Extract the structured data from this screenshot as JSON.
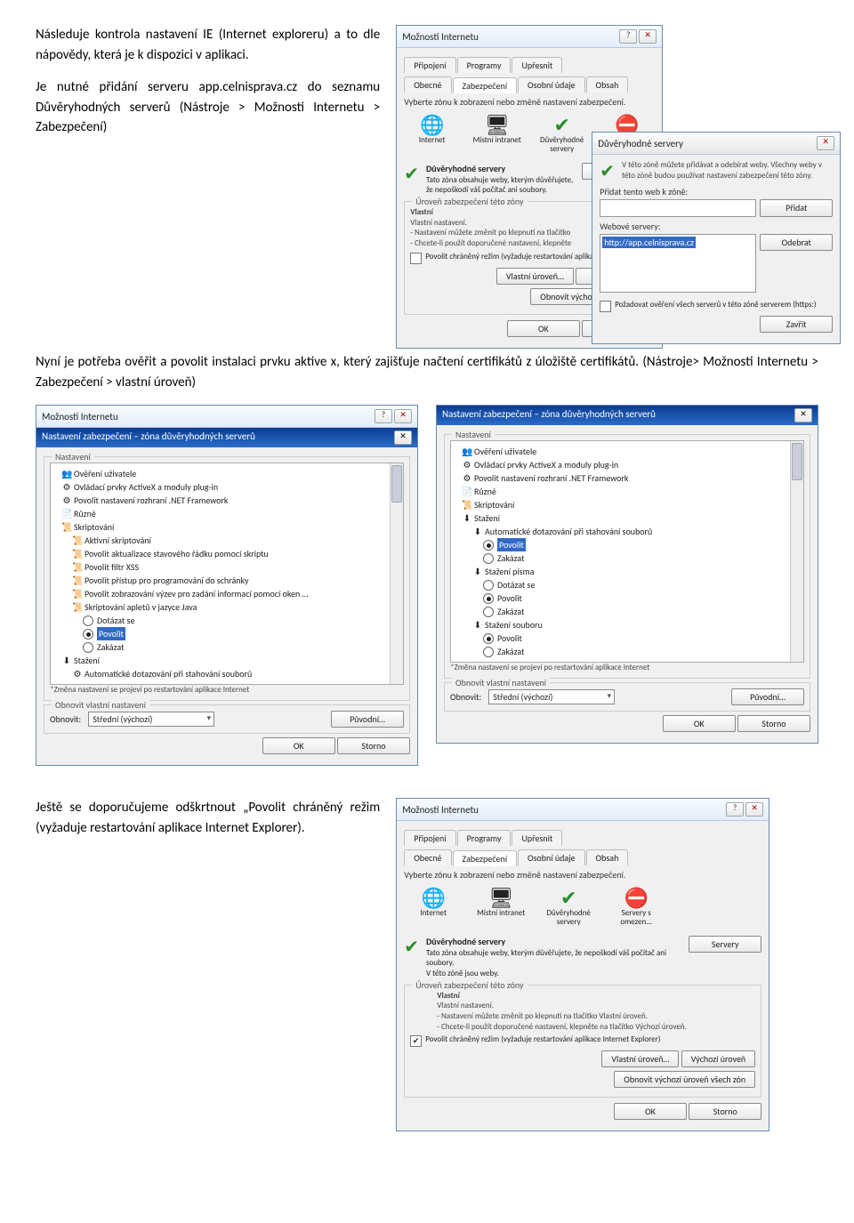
{
  "para1": "Následuje kontrola nastavení IE (Internet exploreru) a to dle nápovědy, která je k dispozici v aplikaci.",
  "para2": "Je nutné přidání serveru app.celnisprava.cz do seznamu Důvěryhodných serverů (Nástroje > Možnosti Internetu > Zabezpečení)",
  "para3": "Nyní je potřeba ověřit a povolit instalaci prvku aktive x, který zajišťuje načtení certifikátů z úložiště certifikátů. (Nástroje> Možnosti Internetu > Zabezpečení > vlastní úroveň)",
  "para4": "Ještě se doporučujeme odškrtnout „Povolit chráněný režim (vyžaduje restartování aplikace Internet Explorer).",
  "win_iopts": {
    "title": "Možnosti Internetu",
    "tabs_row1": [
      "Připojení",
      "Programy",
      "Upřesnit"
    ],
    "tabs_row2": [
      "Obecné",
      "Zabezpečení",
      "Osobní údaje",
      "Obsah"
    ],
    "zone_instr": "Vyberte zónu k zobrazení nebo změně nastavení zabezpečení.",
    "zones": [
      {
        "icon": "🌐",
        "label": "Internet"
      },
      {
        "icon": "🖥",
        "label": "Místní intranet"
      },
      {
        "icon": "✔",
        "label": "Důvěryhodné servery",
        "cls": "chk"
      },
      {
        "icon": "⛔",
        "label": "Servery s omezen...",
        "cls": "no"
      }
    ],
    "trusted_title": "Důvěryhodné servery",
    "trusted_desc": "Tato zóna obsahuje weby, kterým důvěřujete, že nepoškodí váš počítač ani soubory.",
    "trusted_desc2": "V této zóně jsou weby.",
    "servers_btn": "Servery",
    "level_legend": "Úroveň zabezpečení této zóny",
    "level_name": "Vlastní",
    "level_line1": "Vlastní nastavení.",
    "level_line2": "- Nastavení můžete změnit po klepnutí na tlačítko Vlastní úroveň.",
    "level_line3": "- Chcete-li použít doporučené nastavení, klepněte na tlačítko Výchozí úroveň.",
    "cb_protected": "Povolit chráněný režim (vyžaduje restartování aplikace Internet Explorer)",
    "btn_custom": "Vlastní úroveň…",
    "btn_default": "Výchozí úroveň",
    "btn_reset": "Obnovit výchozí úroveň všech zón",
    "ok": "OK",
    "cancel": "Storno"
  },
  "win_trusted": {
    "title": "Důvěryhodné servery",
    "info": "V této zóně můžete přidávat a odebírat weby. Všechny weby v této zóně budou používat nastavení zabezpečení této zóny.",
    "add_web_lbl": "Přidat tento web k zóně:",
    "add_btn": "Přidat",
    "list_lbl": "Webové servery:",
    "list_item": "http://app.celnisprava.cz",
    "remove_btn": "Odebrat",
    "require_https": "Požadovat ověření všech serverů v této zóně serverem (https:)",
    "close_btn": "Zavřít"
  },
  "win_sec_left": {
    "title": "Možnosti Internetu",
    "subtitle": "Nastavení zabezpečení – zóna důvěryhodných serverů",
    "legend": "Nastavení",
    "items": [
      {
        "ic": "👥",
        "txt": "Ověření uživatele",
        "lvl": 1
      },
      {
        "ic": "⚙",
        "txt": "Ovládací prvky ActiveX a moduly plug-in",
        "lvl": 1
      },
      {
        "ic": "⚙",
        "txt": "Povolit nastavení rozhraní .NET Framework",
        "lvl": 1
      },
      {
        "ic": "📄",
        "txt": "Různé",
        "lvl": 1
      },
      {
        "ic": "📜",
        "txt": "Skriptování",
        "lvl": 1
      },
      {
        "ic": "📜",
        "txt": "Aktivní skriptování",
        "lvl": 2
      },
      {
        "ic": "📜",
        "txt": "Povolit aktualizace stavového řádku pomocí skriptu",
        "lvl": 2
      },
      {
        "ic": "📜",
        "txt": "Povolit filtr XSS",
        "lvl": 2
      },
      {
        "ic": "📜",
        "txt": "Povolit přístup pro programování do schránky",
        "lvl": 2
      },
      {
        "ic": "📜",
        "txt": "Povolit zobrazování výzev pro zadání informací pomocí oken …",
        "lvl": 2
      },
      {
        "ic": "📜",
        "txt": "Skriptování apletů v jazyce Java",
        "lvl": 2
      }
    ],
    "radios": [
      {
        "label": "Dotázat se",
        "sel": false
      },
      {
        "label": "Povolit",
        "sel": true,
        "hl": true
      },
      {
        "label": "Zakázat",
        "sel": false
      }
    ],
    "more": [
      {
        "ic": "⬇",
        "txt": "Stažení",
        "lvl": 1
      },
      {
        "ic": "⚙",
        "txt": "Automatické dotazování při stahování souborů",
        "lvl": 2
      }
    ],
    "note": "*Změna nastavení se projeví po restartování aplikace Internet",
    "reset_legend": "Obnovit vlastní nastavení",
    "reset_lbl": "Obnovit:",
    "reset_select": "Střední (výchozí)",
    "reset_btn": "Původní…",
    "ok": "OK",
    "cancel": "Storno"
  },
  "win_sec_right": {
    "title": "Nastavení zabezpečení – zóna důvěryhodných serverů",
    "legend": "Nastavení",
    "items": [
      {
        "ic": "👥",
        "txt": "Ověření uživatele",
        "lvl": 1
      },
      {
        "ic": "⚙",
        "txt": "Ovládací prvky ActiveX a moduly plug-in",
        "lvl": 1
      },
      {
        "ic": "⚙",
        "txt": "Povolit nastavení rozhraní .NET Framework",
        "lvl": 1
      },
      {
        "ic": "📄",
        "txt": "Různé",
        "lvl": 1
      },
      {
        "ic": "📜",
        "txt": "Skriptování",
        "lvl": 1
      },
      {
        "ic": "⬇",
        "txt": "Stažení",
        "lvl": 1
      },
      {
        "ic": "⬇",
        "txt": "Automatické dotazování při stahování souborů",
        "lvl": 2
      }
    ],
    "radiosA": [
      {
        "label": "Povolit",
        "sel": true,
        "hl": true
      },
      {
        "label": "Zakázat",
        "sel": false
      }
    ],
    "itemB": {
      "ic": "⬇",
      "txt": "Stažení písma",
      "lvl": 2
    },
    "radiosB": [
      {
        "label": "Dotázat se",
        "sel": false
      },
      {
        "label": "Povolit",
        "sel": true
      },
      {
        "label": "Zakázat",
        "sel": false
      }
    ],
    "itemC": {
      "ic": "⬇",
      "txt": "Stažení souboru",
      "lvl": 2
    },
    "radiosC": [
      {
        "label": "Povolit",
        "sel": true
      },
      {
        "label": "Zakázat",
        "sel": false
      }
    ],
    "note": "*Změna nastavení se projeví po restartování aplikace Internet",
    "reset_legend": "Obnovit vlastní nastavení",
    "reset_lbl": "Obnovit:",
    "reset_select": "Střední (výchozí)",
    "reset_btn": "Původní…",
    "ok": "OK",
    "cancel": "Storno"
  }
}
